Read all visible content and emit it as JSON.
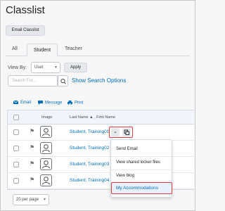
{
  "page": {
    "title": "Classlist",
    "email_classlist": "Email Classlist"
  },
  "tabs": [
    "All",
    "Student",
    "Teacher"
  ],
  "active_tab": "Student",
  "filters": {
    "view_by_label": "View By:",
    "view_by_value": "User",
    "apply_label": "Apply",
    "search_placeholder": "Search For...",
    "show_search_options": "Show Search Options"
  },
  "toolbar": {
    "email": "Email",
    "message": "Message",
    "print": "Print"
  },
  "table": {
    "headers": {
      "image": "Image",
      "name": "Last Name ▲ , First Name"
    },
    "rows": [
      {
        "name": "Student, Training01"
      },
      {
        "name": "Student, Training02"
      },
      {
        "name": "Student, Training03"
      },
      {
        "name": "Student, Training04"
      }
    ]
  },
  "context_menu": {
    "items": [
      "Send Email",
      "View shared locker files",
      "View blog"
    ],
    "highlighted": "My Accommodations"
  },
  "pagination": {
    "per_page": "20 per page"
  },
  "colors": {
    "link": "#006fbf",
    "highlight": "#e03c3c"
  }
}
